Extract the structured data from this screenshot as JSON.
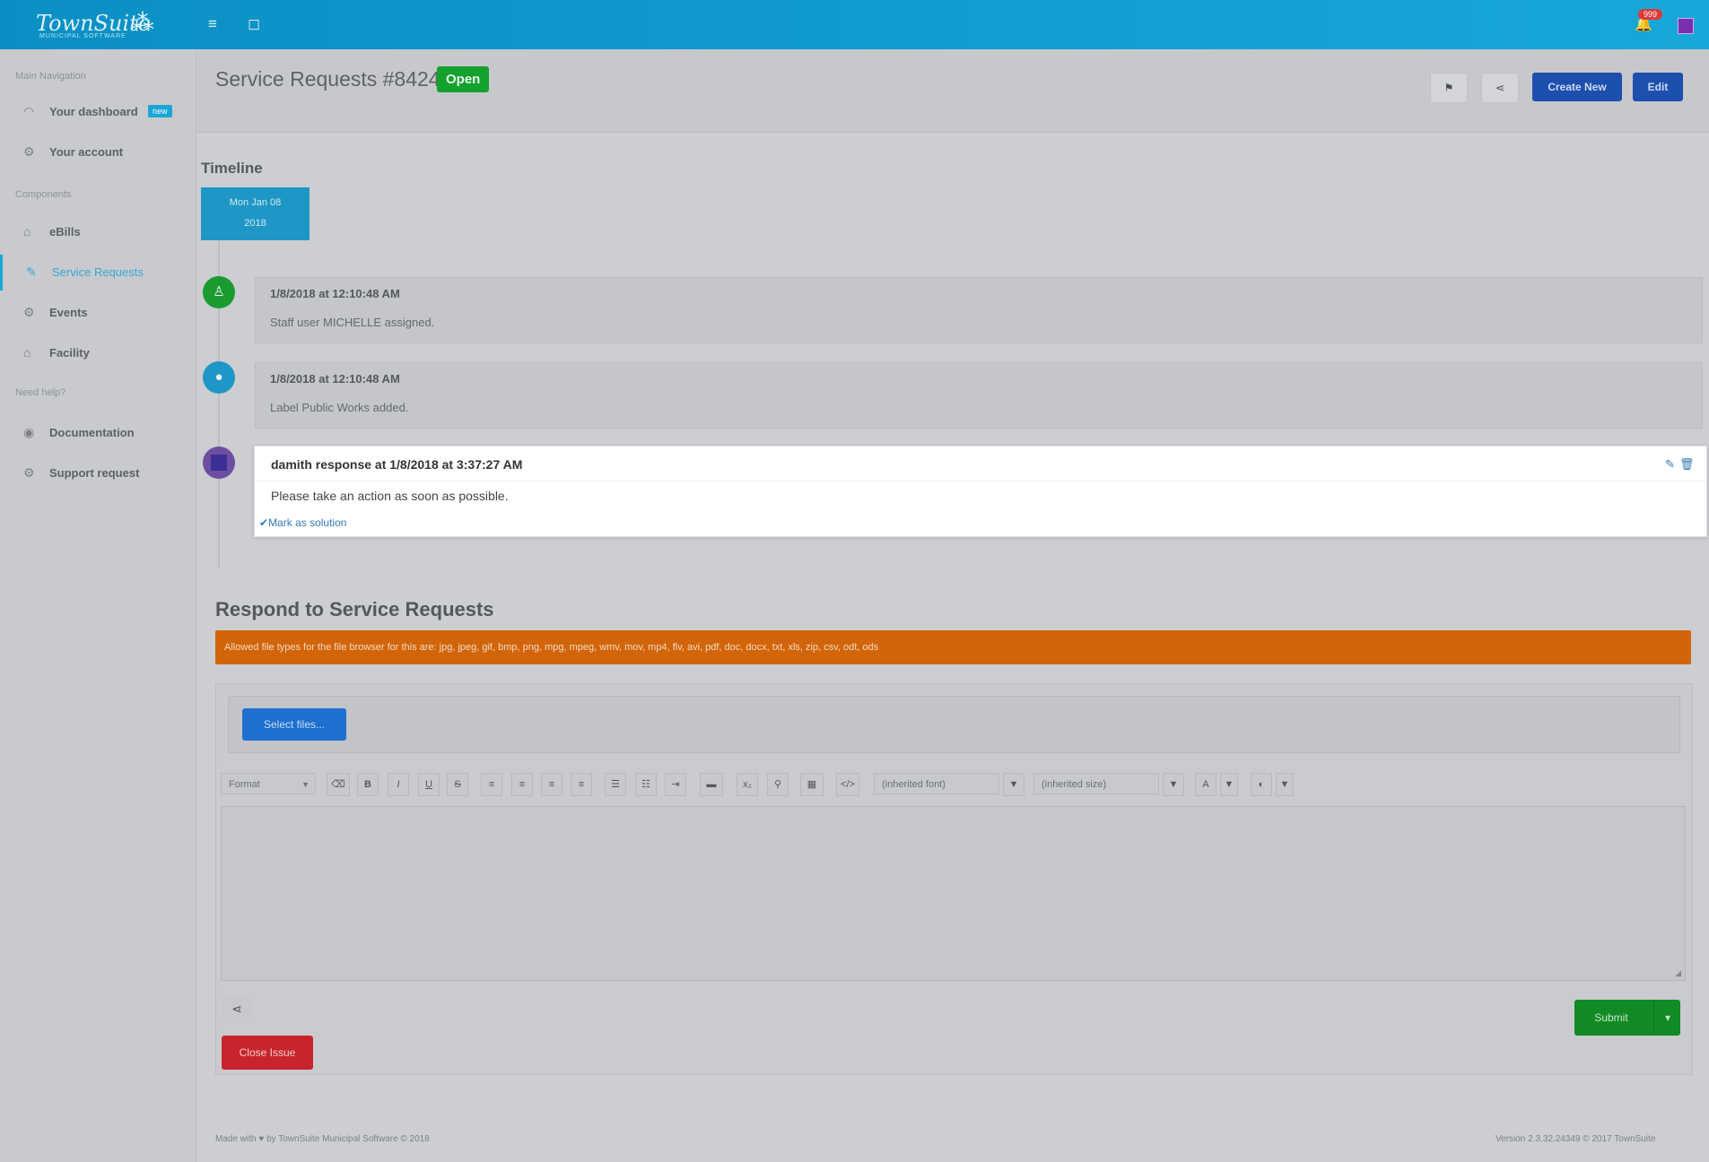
{
  "app": {
    "logo_text": "TownSuite",
    "logo_subtitle": "MUNICIPAL SOFTWARE",
    "notification_count": "999"
  },
  "sidebar": {
    "section_main": "Main Navigation",
    "main_items": [
      {
        "label": "Your dashboard",
        "icon": "dashboard-icon",
        "badge": "new"
      },
      {
        "label": "Your account",
        "icon": "gear-icon"
      }
    ],
    "section_components": "Components",
    "component_items": [
      {
        "label": "eBills",
        "icon": "home-icon"
      },
      {
        "label": "Service Requests",
        "icon": "edit-icon"
      },
      {
        "label": "Events",
        "icon": "gear-icon"
      },
      {
        "label": "Facility",
        "icon": "home-icon"
      }
    ],
    "section_help": "Need help?",
    "help_items": [
      {
        "label": "Documentation",
        "icon": "eye-icon"
      },
      {
        "label": "Support request",
        "icon": "gear-icon"
      }
    ]
  },
  "header": {
    "title": "Service Requests #8424",
    "status": "Open",
    "create_new_label": "Create New",
    "edit_label": "Edit"
  },
  "timeline": {
    "title": "Timeline",
    "date_line1": "Mon Jan 08",
    "date_line2": "2018",
    "events": [
      {
        "when": "1/8/2018 at 12:10:48 AM",
        "what": "Staff user MICHELLE assigned.",
        "icon": "user-icon",
        "color": "#1a9b30"
      },
      {
        "when": "1/8/2018 at 12:10:48 AM",
        "what": "Label Public Works added.",
        "icon": "tag-icon",
        "color": "#1f97c6"
      }
    ],
    "response": {
      "heading": "damith response at 1/8/2018 at 3:37:27 AM",
      "body": "Please take an action as soon as possible.",
      "mark_solution": "Mark as solution"
    }
  },
  "respond": {
    "title": "Respond to Service Requests",
    "file_types_notice": "Allowed file types for the file browser for this are: jpg, jpeg, gif, bmp, png, mpg, mpeg, wmv, mov, mp4, flv, avi, pdf, doc, docx, txt, xls, zip, csv, odt, ods",
    "select_files": "Select files...",
    "format_select": "Format",
    "font_select": "(inherited font)",
    "size_select": "(inherited size)",
    "submit_label": "Submit",
    "close_label": "Close Issue"
  },
  "footer": {
    "left": "Made with ♥ by TownSuite Municipal Software © 2018",
    "right": "Version 2.3.32.24349 © 2017 TownSuite"
  },
  "colors": {
    "topbar": "#0a8fc4",
    "accent": "#1ca6d6",
    "open_badge": "#14a12e",
    "warning": "#d2650a",
    "submit": "#128a26",
    "close": "#c8242d"
  }
}
